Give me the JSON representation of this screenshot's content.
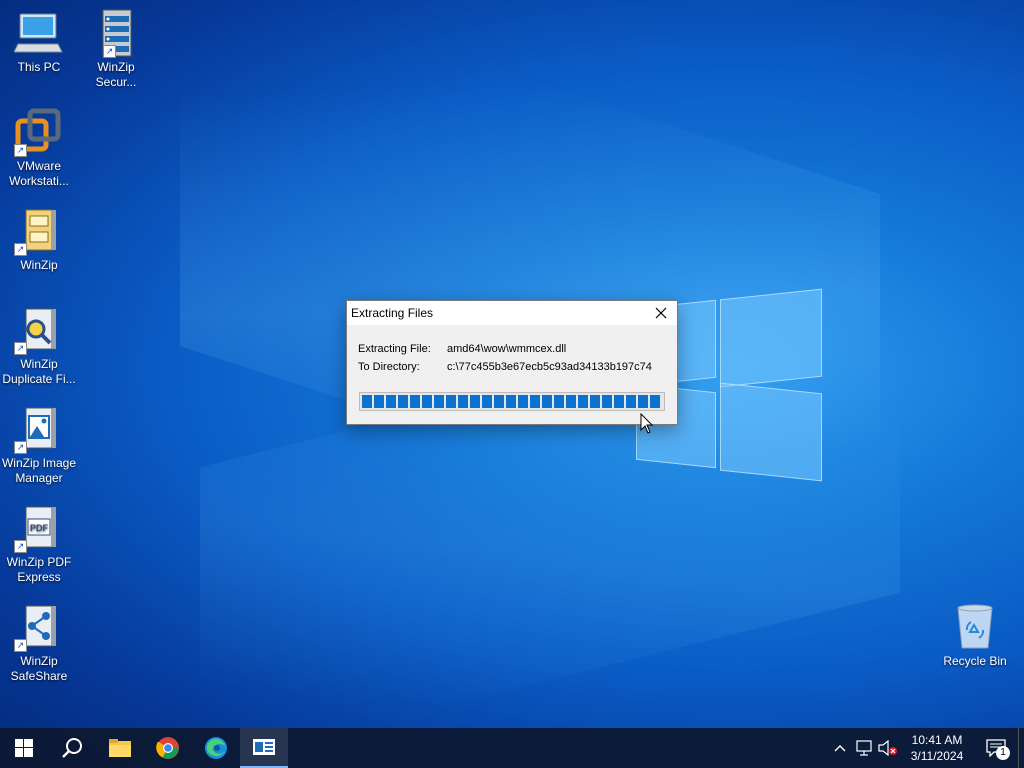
{
  "desktop": {
    "icons": [
      {
        "label": "This PC"
      },
      {
        "label": "WinZip Secur..."
      },
      {
        "label": "VMware Workstati..."
      },
      {
        "label": "WinZip"
      },
      {
        "label": "WinZip Duplicate Fi..."
      },
      {
        "label": "WinZip Image Manager"
      },
      {
        "label": "WinZip PDF Express"
      },
      {
        "label": "WinZip SafeShare"
      },
      {
        "label": "Recycle Bin"
      }
    ],
    "pdf_icon_text": "PDF"
  },
  "dialog": {
    "title": "Extracting Files",
    "file_label": "Extracting File:",
    "file_value": "amd64\\wow\\wmmcex.dll",
    "dir_label": "To Directory:",
    "dir_value": "c:\\77c455b3e67ecb5c93ad34133b197c74",
    "progress_fraction": 1.0,
    "progress_color": "#0b72cf"
  },
  "taskbar": {
    "pinned": [
      "start-icon",
      "search-icon",
      "file-explorer-icon",
      "chrome-icon",
      "edge-icon",
      "extract-app-icon"
    ],
    "time": "10:41 AM",
    "date": "3/11/2024",
    "notification_count": "1"
  },
  "colors": {
    "accent": "#0b72cf",
    "taskbar_bg": "#0c1830"
  }
}
